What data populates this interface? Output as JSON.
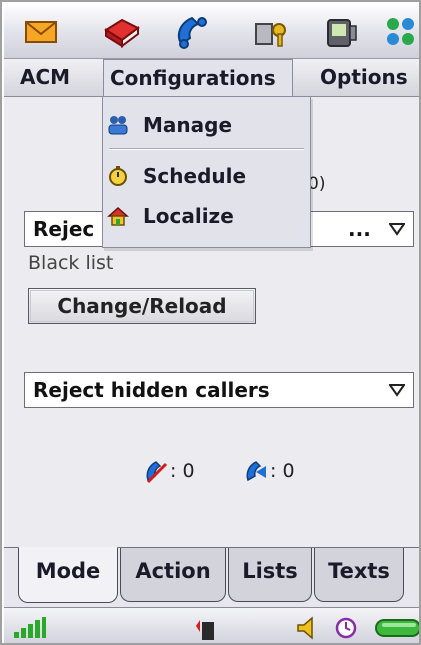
{
  "toolbar_icons": [
    "envelope-icon",
    "book-icon",
    "phone-icon",
    "key-phone-icon",
    "device-icon",
    "grid-icon"
  ],
  "menubar": {
    "acm": "ACM",
    "configurations": "Configurations",
    "options": "Options"
  },
  "dropdown": {
    "items": [
      {
        "label": "Manage",
        "icon": "people-icon"
      },
      {
        "label": "Schedule",
        "icon": "stopwatch-icon"
      },
      {
        "label": "Localize",
        "icon": "home-icon"
      }
    ]
  },
  "main": {
    "mode_select_value": "Rejec",
    "mode_select_tail": "...",
    "hidden_partial": "0)",
    "black_list_label": "Black list",
    "change_reload_button": "Change/Reload",
    "hidden_callers_select": "Reject hidden callers",
    "rejected_count": ": 0",
    "incoming_count": ": 0"
  },
  "tabs": [
    "Mode",
    "Action",
    "Lists",
    "Texts"
  ],
  "active_tab": "Mode",
  "colors": {
    "accent_green": "#3cb83c",
    "menu_bg": "#e2e3ea"
  }
}
